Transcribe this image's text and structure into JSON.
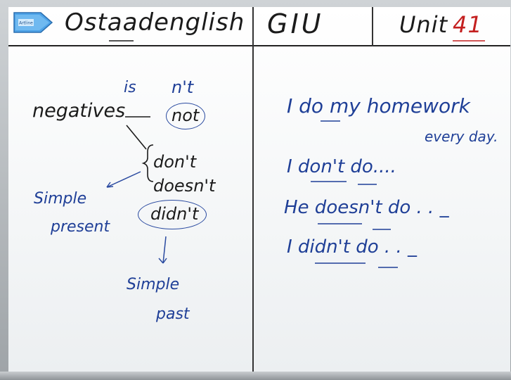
{
  "header": {
    "brand": "Ostaadenglish",
    "middle": "GIU",
    "unit_label": "Unit",
    "unit_number": "41"
  },
  "eraser": {
    "label": "Artline"
  },
  "left_panel": {
    "root": "negatives",
    "is": "is",
    "nt": "n't",
    "not": "not",
    "dont": "don't",
    "doesnt": "doesn't",
    "didnt": "didn't",
    "simple_present_1": "Simple",
    "simple_present_2": "present",
    "simple_past_1": "Simple",
    "simple_past_2": "past"
  },
  "right_panel": {
    "line1": "I do my homework",
    "line1b": "every day.",
    "line2": "I don't do....",
    "line3": "He doesn't do . . _",
    "line4": "I didn't do . . _"
  },
  "colors": {
    "marker_black": "#1b1b1b",
    "marker_blue": "#1f3f97",
    "marker_red": "#c42020"
  }
}
